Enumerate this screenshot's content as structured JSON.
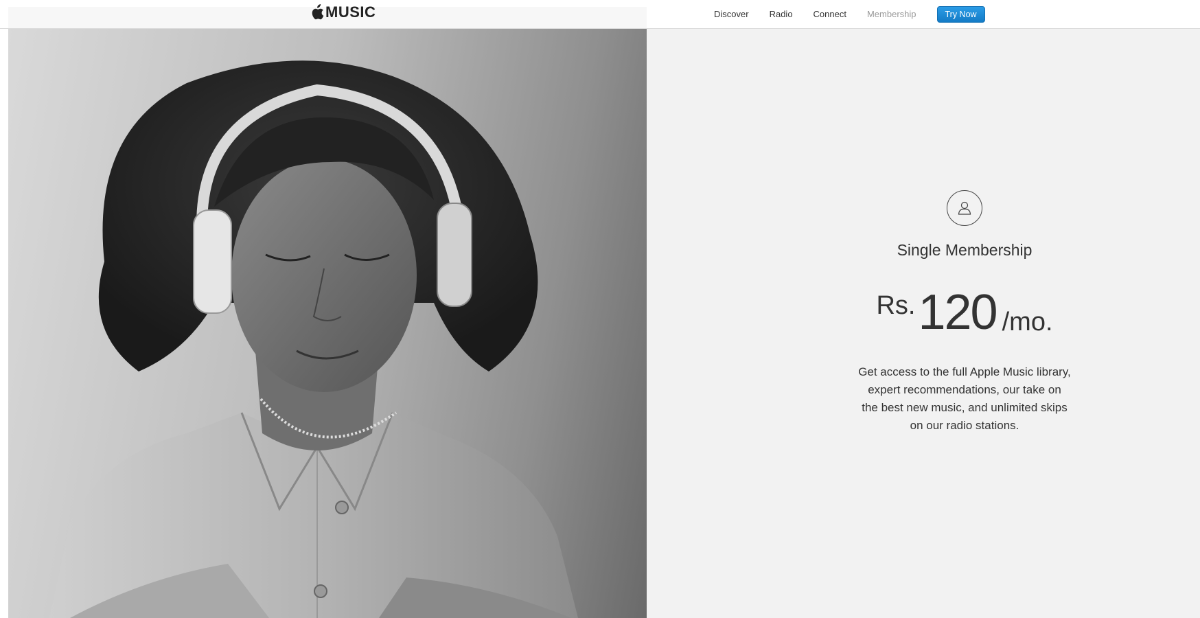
{
  "header": {
    "logo_text": "MUSIC",
    "nav": [
      {
        "label": "Discover"
      },
      {
        "label": "Radio"
      },
      {
        "label": "Connect"
      },
      {
        "label": "Membership"
      }
    ],
    "cta_label": "Try Now"
  },
  "plan": {
    "icon": "person-icon",
    "title": "Single Membership",
    "price_currency": "Rs.",
    "price_amount": "120",
    "price_period": "/mo.",
    "description_lines": [
      "Get access to the full Apple Music library,",
      "expert recommendations, our take on",
      "the best new music, and unlimited skips",
      "on our radio stations."
    ]
  },
  "colors": {
    "accent": "#1a8ad6",
    "background": "#f2f2f2",
    "active_nav": "#999999"
  }
}
